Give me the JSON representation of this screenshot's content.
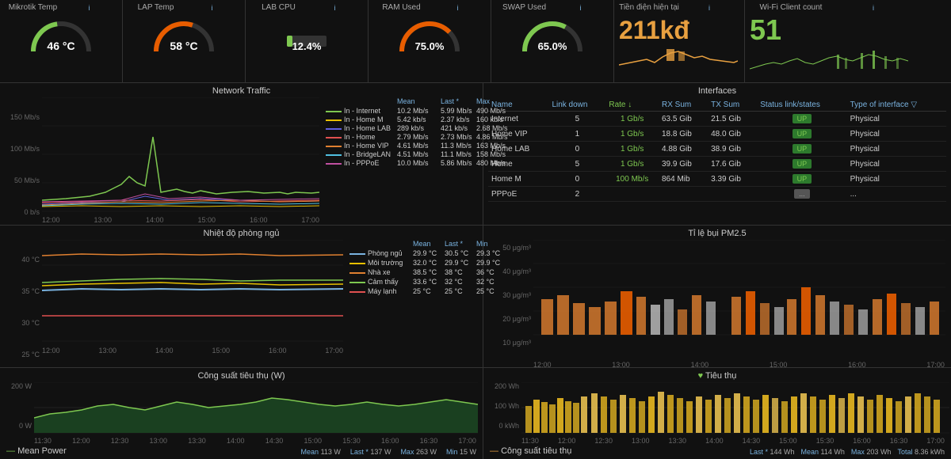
{
  "gauges": {
    "mikrotik": {
      "title": "Mikrotik Temp",
      "value": "46 °C",
      "color": "#7ec850",
      "arc_pct": 0.45
    },
    "lap": {
      "title": "LAP Temp",
      "value": "58 °C",
      "color": "#e85d00",
      "arc_pct": 0.6
    },
    "lab_cpu": {
      "title": "LAB CPU",
      "value": "12.4%",
      "color": "#7ec850",
      "arc_pct": 0.13
    },
    "ram": {
      "title": "RAM Used",
      "value": "75.0%",
      "color": "#e85d00",
      "arc_pct": 0.75
    },
    "swap": {
      "title": "SWAP Used",
      "value": "65.0%",
      "color": "#7ec850",
      "arc_pct": 0.65
    },
    "tien_dien": {
      "title": "Tiền điện hiện tại",
      "value": "211kđ",
      "value_color": "#e8a040"
    },
    "wifi": {
      "title": "Wi-Fi Client count",
      "value": "51",
      "value_color": "#7ec850"
    }
  },
  "network_traffic": {
    "title": "Network Traffic",
    "y_labels": [
      "150 Mb/s",
      "100 Mb/s",
      "50 Mb/s",
      "0 b/s"
    ],
    "x_labels": [
      "12:00",
      "13:00",
      "14:00",
      "15:00",
      "16:00",
      "17:00"
    ],
    "legend_headers": [
      "",
      "Mean",
      "Last *",
      "Max"
    ],
    "legend": [
      {
        "label": "In - Internet",
        "color": "#7ec850",
        "mean": "10.2 Mb/s",
        "last": "5.99 Mb/s",
        "max": "490 Mb/s"
      },
      {
        "label": "In - Home M",
        "color": "#e8c000",
        "mean": "5.42 kb/s",
        "last": "2.37 kb/s",
        "max": "160 kb/s"
      },
      {
        "label": "In - Home LAB",
        "color": "#6060e0",
        "mean": "289 kb/s",
        "last": "421 kb/s",
        "max": "2.68 Mb/s"
      },
      {
        "label": "In - Home",
        "color": "#e05050",
        "mean": "2.79 Mb/s",
        "last": "2.73 Mb/s",
        "max": "4.86 Mb/s"
      },
      {
        "label": "In - Home VIP",
        "color": "#e08030",
        "mean": "4.61 Mb/s",
        "last": "11.3 Mb/s",
        "max": "163 Mb/s"
      },
      {
        "label": "In - BridgeLAN",
        "color": "#50c0e0",
        "mean": "4.51 Mb/s",
        "last": "11.1 Mb/s",
        "max": "158 Mb/s"
      },
      {
        "label": "In - PPPoE",
        "color": "#c050a0",
        "mean": "10.0 Mb/s",
        "last": "5.86 Mb/s",
        "max": "480 Mb/s"
      }
    ]
  },
  "interfaces": {
    "title": "Interfaces",
    "headers": [
      "Name",
      "Link down",
      "Rate ↓",
      "RX Sum",
      "TX Sum",
      "Status link/states",
      "Type of interface"
    ],
    "rows": [
      {
        "name": "Internet",
        "link_down": "5",
        "rate": "1 Gb/s",
        "rx": "63.5 Gib",
        "tx": "21.5 Gib",
        "status": "UP",
        "type": "Physical"
      },
      {
        "name": "Home VIP",
        "link_down": "1",
        "rate": "1 Gb/s",
        "rx": "18.8 Gib",
        "tx": "48.0 Gib",
        "status": "UP",
        "type": "Physical"
      },
      {
        "name": "Home LAB",
        "link_down": "0",
        "rate": "1 Gb/s",
        "rx": "4.88 Gib",
        "tx": "38.9 Gib",
        "status": "UP",
        "type": "Physical"
      },
      {
        "name": "Home",
        "link_down": "5",
        "rate": "1 Gb/s",
        "rx": "39.9 Gib",
        "tx": "17.6 Gib",
        "status": "UP",
        "type": "Physical"
      },
      {
        "name": "Home M",
        "link_down": "0",
        "rate": "100 Mb/s",
        "rx": "864 Mib",
        "tx": "3.39 Gib",
        "status": "UP",
        "type": "Physical"
      },
      {
        "name": "PPPoE",
        "link_down": "2",
        "rate": "",
        "rx": "",
        "tx": "",
        "status": "...",
        "type": "..."
      }
    ]
  },
  "temp_chart": {
    "title": "Nhiệt độ phòng ngủ",
    "y_labels": [
      "40 °C",
      "35 °C",
      "30 °C",
      "25 °C"
    ],
    "x_labels": [
      "12:00",
      "13:00",
      "14:00",
      "15:00",
      "16:00",
      "17:00"
    ],
    "legend_headers": [
      "",
      "Mean",
      "Last *",
      "Min"
    ],
    "legend": [
      {
        "label": "Phòng ngủ",
        "color": "#7ab3e0",
        "mean": "29.9 °C",
        "last": "30.5 °C",
        "min": "29.3 °C"
      },
      {
        "label": "Môi trường",
        "color": "#e8c000",
        "mean": "32.0 °C",
        "last": "29.9 °C",
        "min": "29.9 °C"
      },
      {
        "label": "Nhà xe",
        "color": "#e08030",
        "mean": "38.5 °C",
        "last": "38 °C",
        "min": "36 °C"
      },
      {
        "label": "Cảm thấy",
        "color": "#7ec850",
        "mean": "33.6 °C",
        "last": "32 °C",
        "min": "32 °C"
      },
      {
        "label": "Máy lạnh",
        "color": "#e05050",
        "mean": "25 °C",
        "last": "25 °C",
        "min": "25 °C"
      }
    ]
  },
  "pm_chart": {
    "title": "Tỉ lệ bụi PM2.5",
    "y_labels": [
      "50 μg/m³",
      "40 μg/m³",
      "30 μg/m³",
      "20 μg/m³",
      "10 μg/m³"
    ],
    "x_labels": [
      "12:00",
      "13:00",
      "14:00",
      "15:00",
      "16:00",
      "17:00"
    ]
  },
  "power_chart": {
    "title": "Công suất tiêu thụ (W)",
    "y_labels": [
      "200 W",
      "0 W"
    ],
    "x_labels": [
      "11:30",
      "12:00",
      "12:30",
      "13:00",
      "13:30",
      "14:00",
      "14:30",
      "15:00",
      "15:30",
      "16:00",
      "16:30",
      "17:00"
    ],
    "legend_label": "Mean Power",
    "legend_color": "#7ec850",
    "stats": {
      "mean_label": "Mean",
      "mean_val": "113 W",
      "last_label": "Last *",
      "last_val": "137 W",
      "max_label": "Max",
      "max_val": "263 W",
      "min_label": "Min",
      "min_val": "15 W"
    }
  },
  "energy_chart": {
    "title": "Tiêu thụ",
    "title_icon": "♥",
    "y_labels": [
      "200 Wh",
      "100 Wh",
      "0 kWh"
    ],
    "x_labels": [
      "11:30",
      "12:00",
      "12:30",
      "13:00",
      "13:30",
      "14:00",
      "14:30",
      "15:00",
      "15:30",
      "16:00",
      "16:30",
      "17:00"
    ],
    "legend_label": "Công suất tiêu thụ",
    "legend_color": "#e8a040",
    "stats": {
      "last_label": "Last *",
      "last_val": "144 Wh",
      "mean_label": "Mean",
      "mean_val": "114 Wh",
      "max_label": "Max",
      "max_val": "203 Wh",
      "total_label": "Total",
      "total_val": "8.36 kWh"
    }
  }
}
